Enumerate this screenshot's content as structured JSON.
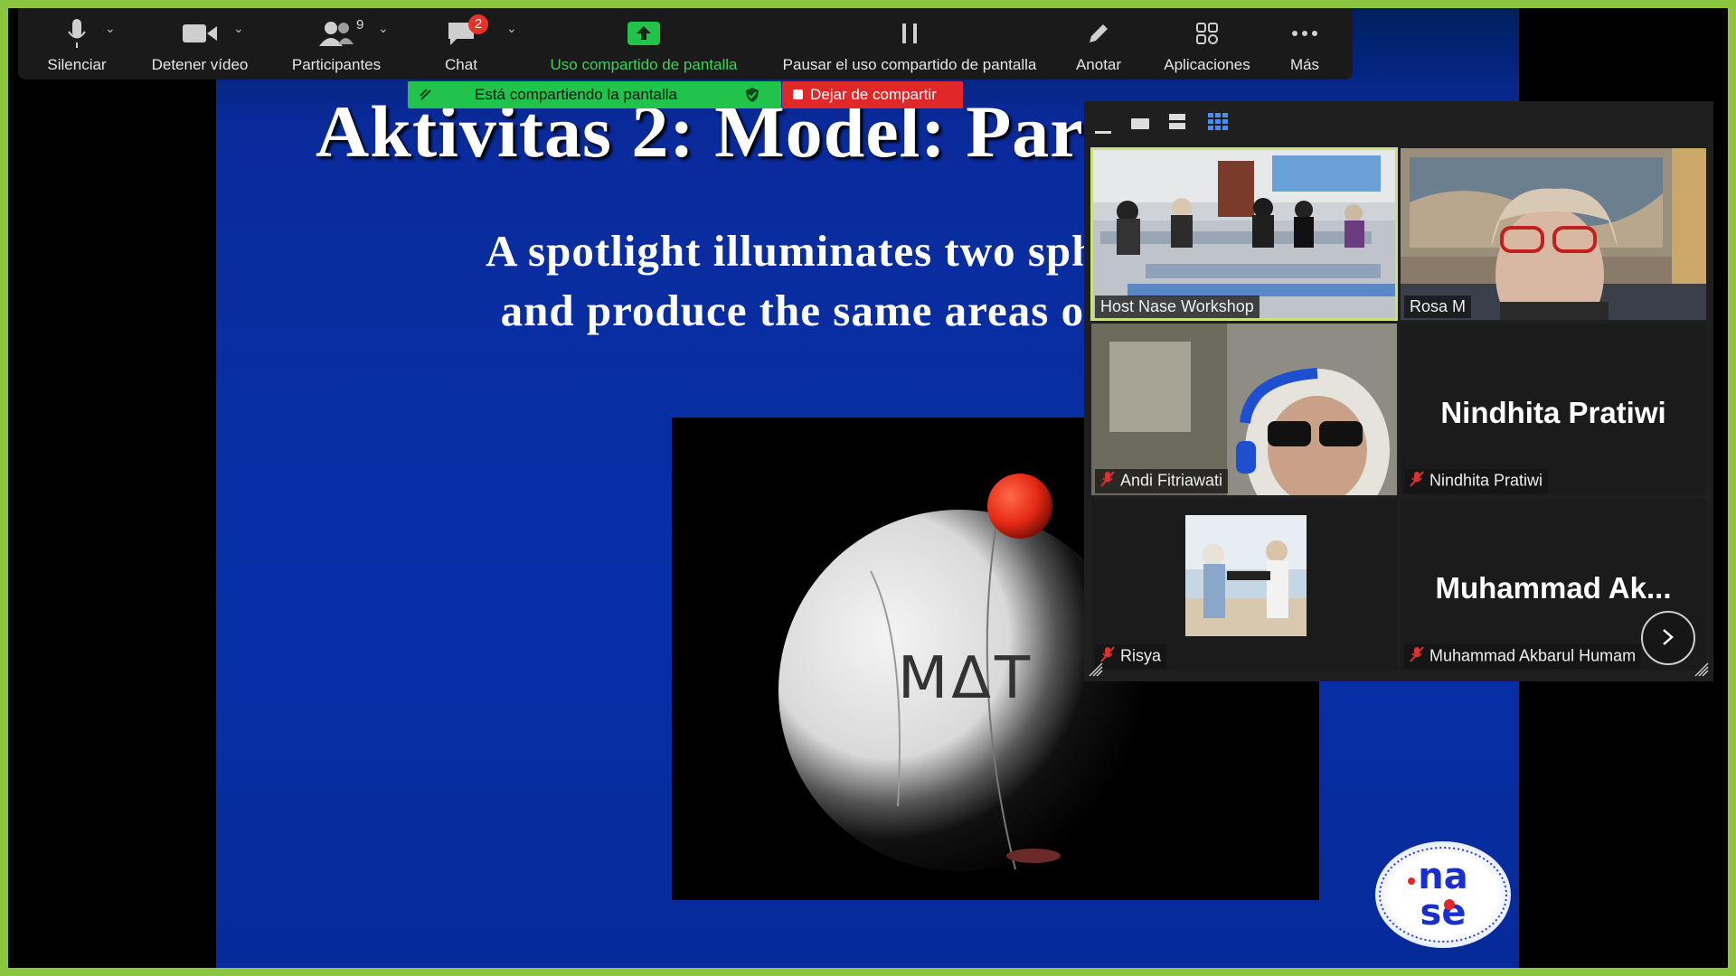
{
  "toolbar": {
    "mute_label": "Silenciar",
    "video_label": "Detener vídeo",
    "participants_label": "Participantes",
    "participants_count": "9",
    "chat_label": "Chat",
    "chat_badge": "2",
    "share_label": "Uso compartido de pantalla",
    "pause_label": "Pausar el uso compartido de pantalla",
    "annotate_label": "Anotar",
    "apps_label": "Aplicaciones",
    "more_label": "Más"
  },
  "share_status": {
    "banner_text": "Está compartiendo la pantalla",
    "stop_label": "Dejar de compartir"
  },
  "slide": {
    "title": "Aktivitas 2: Model: Par",
    "body_line1": "A spotlight illuminates two spheres",
    "body_line2": "and produce the same areas of lig",
    "ball_text": "MΔT"
  },
  "gallery": {
    "tiles": [
      {
        "name": "Host Nase Workshop",
        "muted": false,
        "video": true,
        "speaking": true
      },
      {
        "name": "Rosa M",
        "muted": false,
        "video": true
      },
      {
        "name": "Andi Fitriawati",
        "muted": true,
        "video": true
      },
      {
        "name": "Nindhita Pratiwi",
        "muted": true,
        "video": false,
        "display": "Nindhita Pratiwi"
      },
      {
        "name": "Risya",
        "muted": true,
        "video": false,
        "avatar": true
      },
      {
        "name": "Muhammad Akbarul Humam",
        "muted": true,
        "video": false,
        "display": "Muhammad  Ak..."
      }
    ]
  },
  "colors": {
    "accent_green": "#3fd35a",
    "stop_red": "#e02828",
    "frame_green": "#8bc53f",
    "slide_blue": "#0730a8"
  }
}
